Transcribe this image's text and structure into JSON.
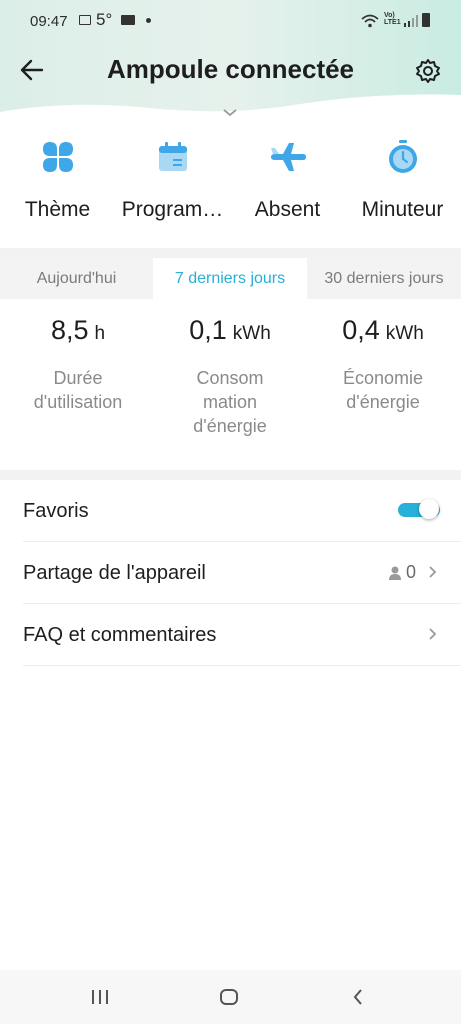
{
  "status_bar": {
    "time": "09:47",
    "temperature": "5°",
    "network": "LTE1",
    "icons": [
      "gallery-icon",
      "mail-icon",
      "dot-icon",
      "wifi-icon",
      "volte-icon",
      "signal-icon",
      "battery-icon"
    ]
  },
  "header": {
    "title": "Ampoule connectée",
    "back_icon": "arrow-left-icon",
    "settings_icon": "gear-icon",
    "collapse_icon": "chevron-down-icon",
    "accent_color": "#cdeee5"
  },
  "actions": [
    {
      "label": "Thème",
      "icon": "theme-grid-icon"
    },
    {
      "label": "Program…",
      "icon": "calendar-icon"
    },
    {
      "label": "Absent",
      "icon": "airplane-icon"
    },
    {
      "label": "Minuteur",
      "icon": "timer-icon"
    }
  ],
  "usage": {
    "tabs": [
      "Aujourd'hui",
      "7 derniers jours",
      "30 derniers jours"
    ],
    "active_tab": "7 derniers jours",
    "stats": [
      {
        "value": "8,5",
        "unit": "h",
        "caption_lines": [
          "Durée",
          "d'utilisation"
        ]
      },
      {
        "value": "0,1",
        "unit": "kWh",
        "caption_lines": [
          "Consom",
          "mation",
          "d'énergie"
        ]
      },
      {
        "value": "0,4",
        "unit": "kWh",
        "caption_lines": [
          "Économie",
          "d'énergie"
        ]
      }
    ]
  },
  "settings": {
    "favorites_label": "Favoris",
    "favorites_on": true,
    "share_label": "Partage de l'appareil",
    "share_count": "0",
    "faq_label": "FAQ et commentaires"
  },
  "colors": {
    "accent": "#27b0d8",
    "icon_blue": "#3fa7e8",
    "icon_light": "#a9d8f5"
  },
  "nav_bar": [
    "recent-apps-icon",
    "home-icon",
    "back-icon"
  ]
}
